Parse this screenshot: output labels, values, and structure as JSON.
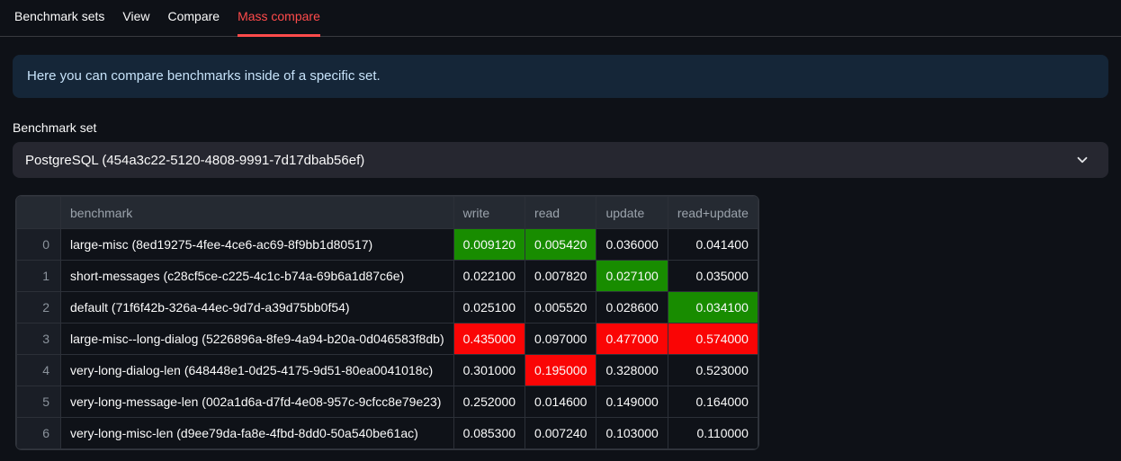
{
  "tabs": [
    {
      "label": "Benchmark sets",
      "active": false
    },
    {
      "label": "View",
      "active": false
    },
    {
      "label": "Compare",
      "active": false
    },
    {
      "label": "Mass compare",
      "active": true
    }
  ],
  "info_banner": {
    "text": "Here you can compare benchmarks inside of a specific set."
  },
  "benchmark_set": {
    "label": "Benchmark set",
    "selected": "PostgreSQL (454a3c22-5120-4808-9991-7d17dbab56ef)"
  },
  "table": {
    "columns": [
      "",
      "benchmark",
      "write",
      "read",
      "update",
      "read+update"
    ],
    "rows": [
      {
        "index": "0",
        "benchmark": "large-misc (8ed19275-4fee-4ce6-ac69-8f9bb1d80517)",
        "write": "0.009120",
        "read": "0.005420",
        "update": "0.036000",
        "read_update": "0.041400",
        "highlights": {
          "write": "green",
          "read": "green"
        }
      },
      {
        "index": "1",
        "benchmark": "short-messages (c28cf5ce-c225-4c1c-b74a-69b6a1d87c6e)",
        "write": "0.022100",
        "read": "0.007820",
        "update": "0.027100",
        "read_update": "0.035000",
        "highlights": {
          "update": "green"
        }
      },
      {
        "index": "2",
        "benchmark": "default (71f6f42b-326a-44ec-9d7d-a39d75bb0f54)",
        "write": "0.025100",
        "read": "0.005520",
        "update": "0.028600",
        "read_update": "0.034100",
        "highlights": {
          "read_update": "green"
        }
      },
      {
        "index": "3",
        "benchmark": "large-misc--long-dialog (5226896a-8fe9-4a94-b20a-0d046583f8db)",
        "write": "0.435000",
        "read": "0.097000",
        "update": "0.477000",
        "read_update": "0.574000",
        "highlights": {
          "write": "red",
          "update": "red",
          "read_update": "red"
        }
      },
      {
        "index": "4",
        "benchmark": "very-long-dialog-len (648448e1-0d25-4175-9d51-80ea0041018c)",
        "write": "0.301000",
        "read": "0.195000",
        "update": "0.328000",
        "read_update": "0.523000",
        "highlights": {
          "read": "red"
        }
      },
      {
        "index": "5",
        "benchmark": "very-long-message-len (002a1d6a-d7fd-4e08-957c-9cfcc8e79e23)",
        "write": "0.252000",
        "read": "0.014600",
        "update": "0.149000",
        "read_update": "0.164000",
        "highlights": {}
      },
      {
        "index": "6",
        "benchmark": "very-long-misc-len (d9ee79da-fa8e-4fbd-8dd0-50a540be61ac)",
        "write": "0.085300",
        "read": "0.007240",
        "update": "0.103000",
        "read_update": "0.110000",
        "highlights": {}
      }
    ]
  },
  "colors": {
    "accent": "#ff4b4b",
    "highlight_green": "#188c00",
    "highlight_red": "#fa0505",
    "banner_bg": "#152638",
    "page_bg": "#0e1117"
  },
  "icons": {
    "select_chevron": "chevron-down"
  }
}
